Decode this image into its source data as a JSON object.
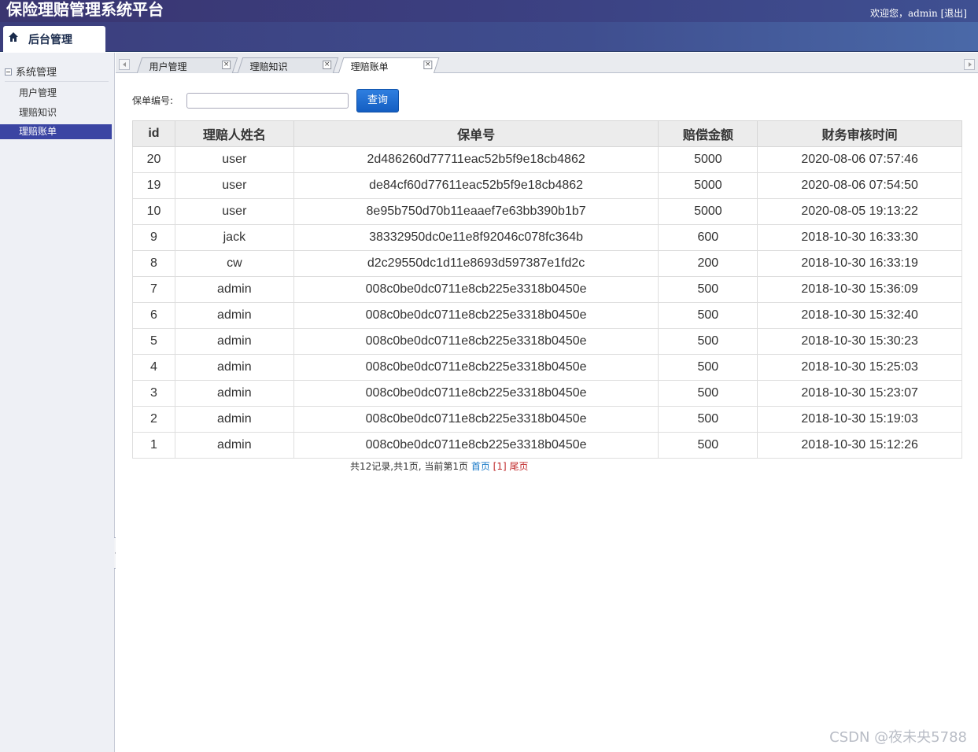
{
  "header": {
    "title": "保险理赔管理系统平台",
    "welcome": "欢迎您，admin",
    "logout": "[退出]"
  },
  "nav": {
    "label": "后台管理"
  },
  "sidebar": {
    "group": "系统管理",
    "items": [
      {
        "label": "用户管理"
      },
      {
        "label": "理赔知识"
      },
      {
        "label": "理赔账单"
      }
    ],
    "active_index": 2
  },
  "tabs": [
    {
      "label": "用户管理"
    },
    {
      "label": "理赔知识"
    },
    {
      "label": "理赔账单"
    }
  ],
  "search": {
    "label": "保单编号:",
    "value": "",
    "placeholder": "",
    "button": "查询"
  },
  "table": {
    "columns": [
      "id",
      "理赔人姓名",
      "保单号",
      "赔偿金额",
      "财务审核时间"
    ],
    "rows": [
      [
        "20",
        "user",
        "2d486260d77711eac52b5f9e18cb4862",
        "5000",
        "2020-08-06 07:57:46"
      ],
      [
        "19",
        "user",
        "de84cf60d77611eac52b5f9e18cb4862",
        "5000",
        "2020-08-06 07:54:50"
      ],
      [
        "10",
        "user",
        "8e95b750d70b11eaaef7e63bb390b1b7",
        "5000",
        "2020-08-05 19:13:22"
      ],
      [
        "9",
        "jack",
        "38332950dc0e11e8f92046c078fc364b",
        "600",
        "2018-10-30 16:33:30"
      ],
      [
        "8",
        "cw",
        "d2c29550dc1d11e8693d597387e1fd2c",
        "200",
        "2018-10-30 16:33:19"
      ],
      [
        "7",
        "admin",
        "008c0be0dc0711e8cb225e3318b0450e",
        "500",
        "2018-10-30 15:36:09"
      ],
      [
        "6",
        "admin",
        "008c0be0dc0711e8cb225e3318b0450e",
        "500",
        "2018-10-30 15:32:40"
      ],
      [
        "5",
        "admin",
        "008c0be0dc0711e8cb225e3318b0450e",
        "500",
        "2018-10-30 15:30:23"
      ],
      [
        "4",
        "admin",
        "008c0be0dc0711e8cb225e3318b0450e",
        "500",
        "2018-10-30 15:25:03"
      ],
      [
        "3",
        "admin",
        "008c0be0dc0711e8cb225e3318b0450e",
        "500",
        "2018-10-30 15:23:07"
      ],
      [
        "2",
        "admin",
        "008c0be0dc0711e8cb225e3318b0450e",
        "500",
        "2018-10-30 15:19:03"
      ],
      [
        "1",
        "admin",
        "008c0be0dc0711e8cb225e3318b0450e",
        "500",
        "2018-10-30 15:12:26"
      ]
    ]
  },
  "pager": {
    "summary": "共12记录,共1页, 当前第1页",
    "first": "首页",
    "current": "[1]",
    "last": "尾页"
  },
  "watermark": "CSDN @夜未央5788",
  "colors": {
    "header_start": "#3a3570",
    "header_end": "#4a69a8",
    "active_item": "#3b45a3",
    "button": "#1e6fd6",
    "link": "#1a7ac8",
    "current_page": "#c0282a"
  }
}
